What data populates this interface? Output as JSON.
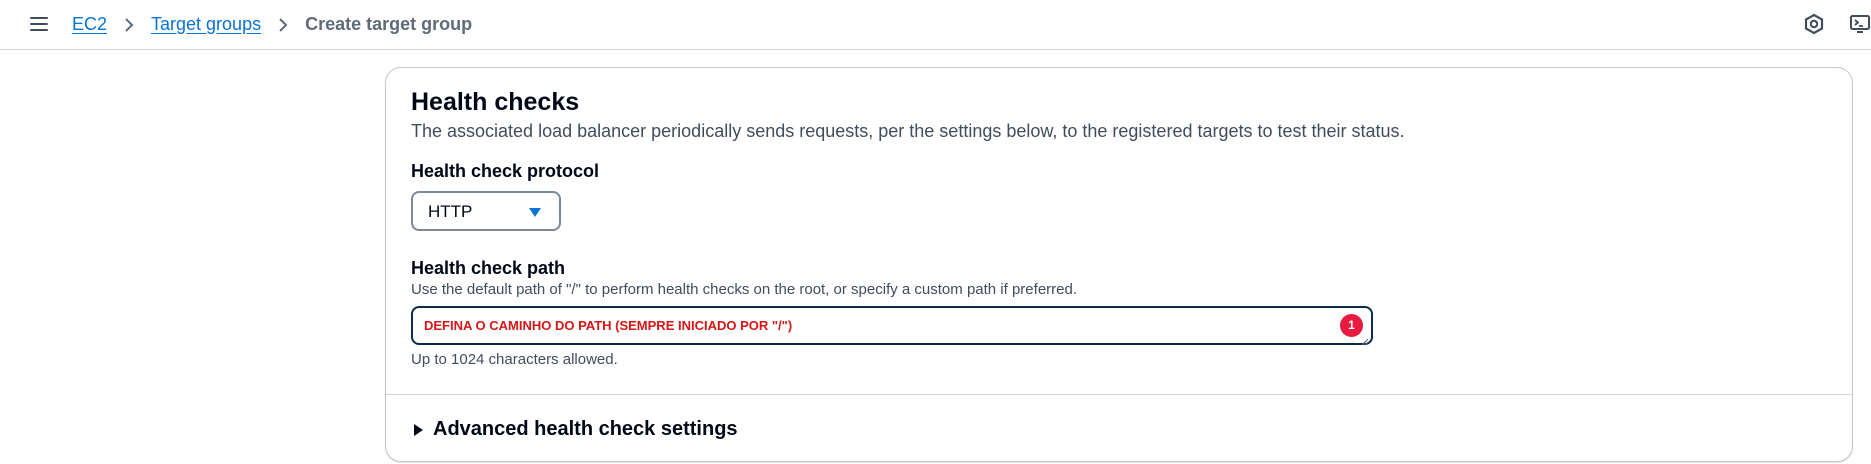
{
  "header": {
    "breadcrumbs": [
      {
        "label": "EC2",
        "link": true
      },
      {
        "label": "Target groups",
        "link": true
      },
      {
        "label": "Create target group",
        "link": false
      }
    ],
    "icons": [
      "menu-icon",
      "notifications-icon",
      "cloudshell-icon"
    ]
  },
  "panel": {
    "title": "Health checks",
    "description": "The associated load balancer periodically sends requests, per the settings below, to the registered targets to test their status.",
    "protocol": {
      "label": "Health check protocol",
      "value": "HTTP"
    },
    "path": {
      "label": "Health check path",
      "description": "Use the default path of \"/\" to perform health checks on the root, or specify a custom path if preferred.",
      "value": "DEFINA O CAMINHO DO PATH (SEMPRE INICIADO POR \"/\")",
      "badge": "1",
      "hint": "Up to 1024 characters allowed."
    },
    "advanced": {
      "label": "Advanced health check settings"
    }
  },
  "colors": {
    "link": "#0972d3",
    "accent_caret": "#0972d3",
    "input_error_text": "#d91515",
    "badge": "#e81a3f"
  }
}
